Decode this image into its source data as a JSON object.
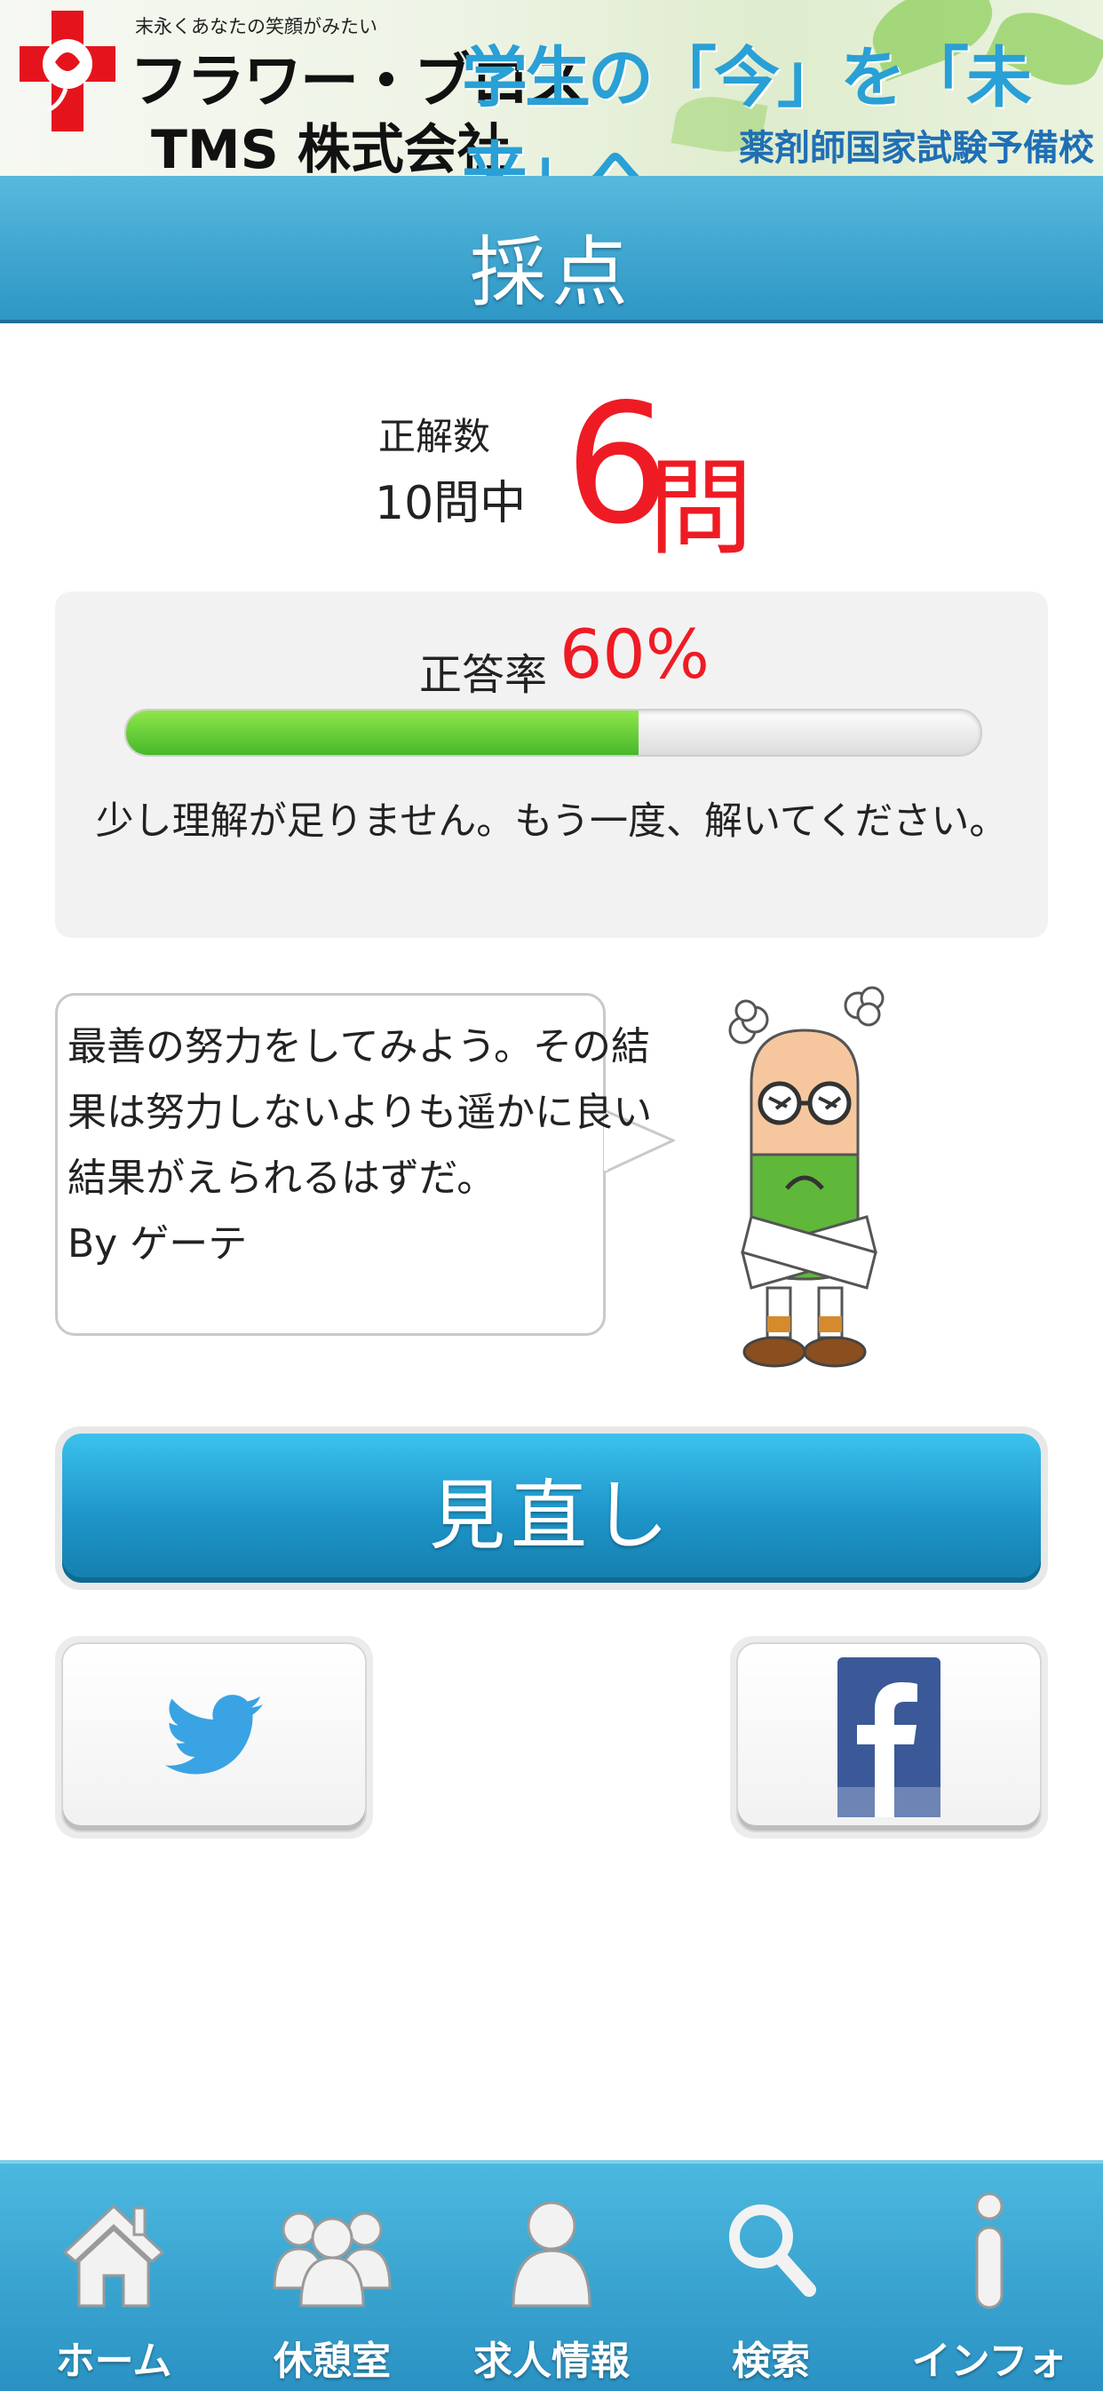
{
  "banner": {
    "tagline": "末永くあなたの笑顔がみたい",
    "brand_line1": "フラワー・ブロス",
    "brand_line2": "TMS 株式会社",
    "slogan": "学生の「今」を「未来」へ",
    "school": "薬剤師国家試験予備校"
  },
  "header": {
    "title": "採点"
  },
  "score": {
    "correct_label": "正解数",
    "total_label": "10問中",
    "correct_count": "6",
    "unit": "問"
  },
  "rate": {
    "label": "正答率",
    "value": "60%",
    "fraction": 0.6,
    "message": "少し理解が足りません。もう一度、解いてください。"
  },
  "quote": {
    "lines": [
      "最善の努力をしてみよう。その結",
      "果は努力しないよりも遥かに良い",
      "結果がえられるはずだ。",
      "By ゲーテ"
    ]
  },
  "buttons": {
    "review": "見直し"
  },
  "colors": {
    "accent_red": "#ee1b24",
    "header_blue": "#2e97c5",
    "progress_green": "#46b82a",
    "twitter": "#3aa3e3",
    "facebook": "#3b5998"
  },
  "tabs": [
    {
      "label": "ホーム",
      "icon": "home-icon"
    },
    {
      "label": "休憩室",
      "icon": "group-icon"
    },
    {
      "label": "求人情報",
      "icon": "person-icon"
    },
    {
      "label": "検索",
      "icon": "search-icon"
    },
    {
      "label": "インフォ",
      "icon": "info-icon"
    }
  ]
}
